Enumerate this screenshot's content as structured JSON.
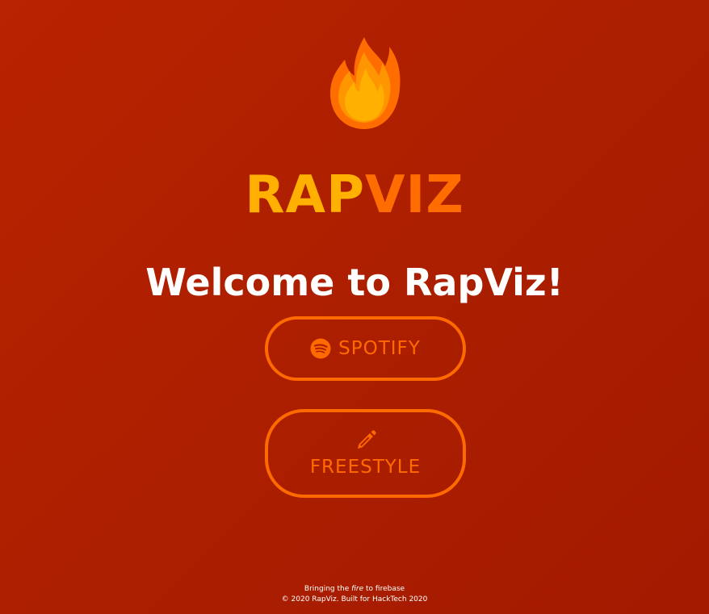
{
  "logo": {
    "part1": "RAP",
    "part2": "VIZ",
    "icon": "flame-icon"
  },
  "welcome": {
    "title": "Welcome to RapViz!"
  },
  "buttons": {
    "spotify": {
      "label": "SPOTIFY",
      "icon": "spotify-icon"
    },
    "freestyle": {
      "label": "FREESTYLE",
      "icon": "pencil-icon"
    }
  },
  "footer": {
    "tagline_before": "Bringing the ",
    "tagline_emphasis": "fire",
    "tagline_after": " to firebase",
    "copyright": "© 2020 RapViz. Built for HackTech 2020"
  },
  "colors": {
    "background": "#ad1f00",
    "accent_orange": "#ff6a00",
    "accent_yellow": "#ffb000",
    "text": "#ffffff"
  }
}
